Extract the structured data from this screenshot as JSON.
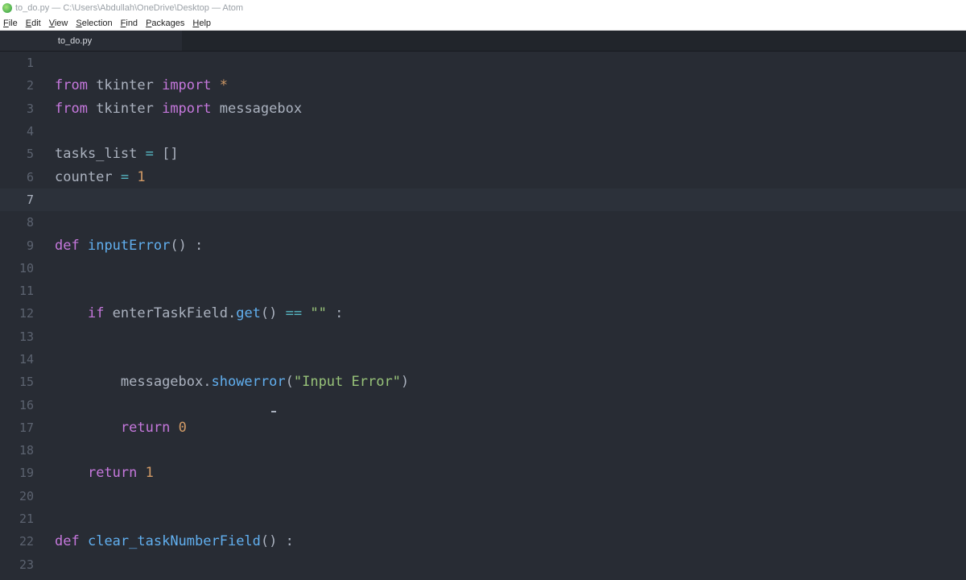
{
  "window": {
    "title": "to_do.py — C:\\Users\\Abdullah\\OneDrive\\Desktop — Atom"
  },
  "menu": [
    "File",
    "Edit",
    "View",
    "Selection",
    "Find",
    "Packages",
    "Help"
  ],
  "tabs": [
    {
      "label": "to_do.py",
      "active": true
    }
  ],
  "editor": {
    "current_line": 7,
    "lines": [
      {
        "n": "1",
        "indent": "",
        "tokens": []
      },
      {
        "n": "2",
        "indent": "",
        "tokens": [
          [
            "keyword",
            "from"
          ],
          [
            "plain",
            " tkinter "
          ],
          [
            "keyword",
            "import"
          ],
          [
            "plain",
            " "
          ],
          [
            "num",
            "*"
          ]
        ]
      },
      {
        "n": "3",
        "indent": "",
        "tokens": [
          [
            "keyword",
            "from"
          ],
          [
            "plain",
            " tkinter "
          ],
          [
            "keyword",
            "import"
          ],
          [
            "plain",
            " messagebox"
          ]
        ]
      },
      {
        "n": "4",
        "indent": "",
        "tokens": []
      },
      {
        "n": "5",
        "indent": "",
        "tokens": [
          [
            "plain",
            "tasks_list "
          ],
          [
            "op",
            "="
          ],
          [
            "plain",
            " []"
          ]
        ]
      },
      {
        "n": "6",
        "indent": "",
        "tokens": [
          [
            "plain",
            "counter "
          ],
          [
            "op",
            "="
          ],
          [
            "plain",
            " "
          ],
          [
            "num",
            "1"
          ]
        ]
      },
      {
        "n": "7",
        "indent": "",
        "tokens": []
      },
      {
        "n": "8",
        "indent": "",
        "tokens": []
      },
      {
        "n": "9",
        "indent": "",
        "tokens": [
          [
            "keyword",
            "def"
          ],
          [
            "plain",
            " "
          ],
          [
            "fn",
            "inputError"
          ],
          [
            "plain",
            "() :"
          ]
        ]
      },
      {
        "n": "10",
        "indent": "",
        "tokens": []
      },
      {
        "n": "11",
        "indent": "",
        "tokens": []
      },
      {
        "n": "12",
        "indent": "    ",
        "tokens": [
          [
            "keyword",
            "if"
          ],
          [
            "plain",
            " enterTaskField."
          ],
          [
            "fn",
            "get"
          ],
          [
            "plain",
            "() "
          ],
          [
            "op",
            "=="
          ],
          [
            "plain",
            " "
          ],
          [
            "str",
            "\"\""
          ],
          [
            "plain",
            " :"
          ]
        ]
      },
      {
        "n": "13",
        "indent": "",
        "tokens": []
      },
      {
        "n": "14",
        "indent": "",
        "tokens": []
      },
      {
        "n": "15",
        "indent": "        ",
        "tokens": [
          [
            "plain",
            "messagebox."
          ],
          [
            "fn",
            "showerror"
          ],
          [
            "plain",
            "("
          ],
          [
            "str",
            "\"Input Error\""
          ],
          [
            "plain",
            ")"
          ]
        ]
      },
      {
        "n": "16",
        "indent": "",
        "tokens": []
      },
      {
        "n": "17",
        "indent": "        ",
        "tokens": [
          [
            "keyword",
            "return"
          ],
          [
            "plain",
            " "
          ],
          [
            "num",
            "0"
          ]
        ]
      },
      {
        "n": "18",
        "indent": "",
        "tokens": []
      },
      {
        "n": "19",
        "indent": "    ",
        "tokens": [
          [
            "keyword",
            "return"
          ],
          [
            "plain",
            " "
          ],
          [
            "num",
            "1"
          ]
        ]
      },
      {
        "n": "20",
        "indent": "",
        "tokens": []
      },
      {
        "n": "21",
        "indent": "",
        "tokens": []
      },
      {
        "n": "22",
        "indent": "",
        "tokens": [
          [
            "keyword",
            "def"
          ],
          [
            "plain",
            " "
          ],
          [
            "fn",
            "clear_taskNumberField"
          ],
          [
            "plain",
            "() :"
          ]
        ]
      },
      {
        "n": "23",
        "indent": "",
        "tokens": []
      }
    ]
  },
  "colors": {
    "background": "#282c34",
    "keyword": "#c678dd",
    "function": "#61afef",
    "number": "#d19a66",
    "string": "#98c379",
    "operator": "#56b6c2",
    "text": "#abb2bf"
  }
}
